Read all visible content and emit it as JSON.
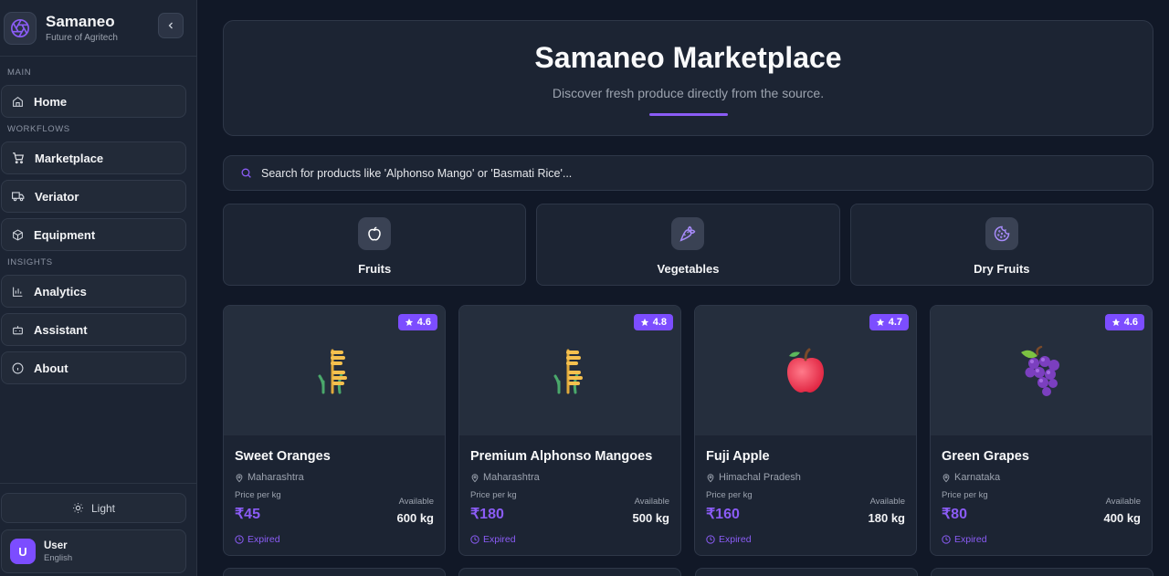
{
  "brand": {
    "name": "Samaneo",
    "tagline": "Future of Agritech"
  },
  "sidebar": {
    "sections": {
      "main": "MAIN",
      "workflows": "WORKFLOWS",
      "insights": "INSIGHTS"
    },
    "items": [
      {
        "label": "Home",
        "icon": "home-icon"
      },
      {
        "label": "Marketplace",
        "icon": "cart-icon"
      },
      {
        "label": "Veriator",
        "icon": "truck-icon"
      },
      {
        "label": "Equipment",
        "icon": "box-icon"
      },
      {
        "label": "Analytics",
        "icon": "chart-icon"
      },
      {
        "label": "Assistant",
        "icon": "bot-icon"
      },
      {
        "label": "About",
        "icon": "info-icon"
      }
    ],
    "theme_label": "Light",
    "user": {
      "initial": "U",
      "name": "User",
      "language": "English"
    }
  },
  "hero": {
    "title": "Samaneo Marketplace",
    "subtitle": "Discover fresh produce directly from the source."
  },
  "search": {
    "placeholder": "Search for products like 'Alphonso Mango' or 'Basmati Rice'..."
  },
  "categories": [
    {
      "label": "Fruits",
      "icon": "apple-icon"
    },
    {
      "label": "Vegetables",
      "icon": "carrot-icon"
    },
    {
      "label": "Dry Fruits",
      "icon": "cookie-icon"
    }
  ],
  "products": [
    {
      "name": "Sweet Oranges",
      "location": "Maharashtra",
      "price_label": "Price per kg",
      "price": "₹45",
      "available_label": "Available",
      "available": "600 kg",
      "status": "Expired",
      "rating": "4.6",
      "icon": "grain-icon"
    },
    {
      "name": "Premium Alphonso Mangoes",
      "location": "Maharashtra",
      "price_label": "Price per kg",
      "price": "₹180",
      "available_label": "Available",
      "available": "500 kg",
      "status": "Expired",
      "rating": "4.8",
      "icon": "grain-icon"
    },
    {
      "name": "Fuji Apple",
      "location": "Himachal Pradesh",
      "price_label": "Price per kg",
      "price": "₹160",
      "available_label": "Available",
      "available": "180 kg",
      "status": "Expired",
      "rating": "4.7",
      "icon": "apple-icon"
    },
    {
      "name": "Green Grapes",
      "location": "Karnataka",
      "price_label": "Price per kg",
      "price": "₹80",
      "available_label": "Available",
      "available": "400 kg",
      "status": "Expired",
      "rating": "4.6",
      "icon": "grapes-icon"
    }
  ],
  "colors": {
    "accent": "#8b5cf6",
    "background": "#111827",
    "panel": "#1c2433"
  }
}
